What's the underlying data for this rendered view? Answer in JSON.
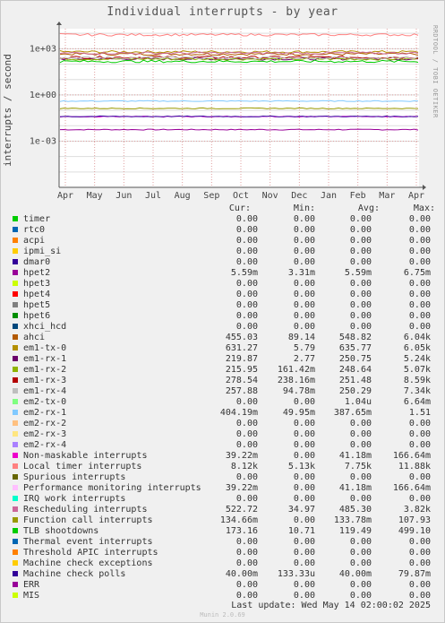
{
  "chart_data": {
    "type": "line",
    "title": "Individual interrupts - by year",
    "ylabel": "interrupts / second",
    "yscale": "log",
    "ylim": [
      1e-06,
      20000
    ],
    "yticks": [
      {
        "label": "1e+03",
        "value": 1000
      },
      {
        "label": "1e+00",
        "value": 1
      },
      {
        "label": "1e-03",
        "value": 0.001
      }
    ],
    "x": [
      "Apr",
      "May",
      "Jun",
      "Jul",
      "Aug",
      "Sep",
      "Oct",
      "Nov",
      "Dec",
      "Jan",
      "Feb",
      "Mar",
      "Apr"
    ],
    "series": [
      {
        "name": "timer",
        "color": "#00cc00",
        "cur": "0.00",
        "min": "0.00",
        "avg": "0.00",
        "max": "0.00",
        "level": 0
      },
      {
        "name": "rtc0",
        "color": "#0066b3",
        "cur": "0.00",
        "min": "0.00",
        "avg": "0.00",
        "max": "0.00",
        "level": 0
      },
      {
        "name": "acpi",
        "color": "#ff8000",
        "cur": "0.00",
        "min": "0.00",
        "avg": "0.00",
        "max": "0.00",
        "level": 0
      },
      {
        "name": "ipmi_si",
        "color": "#ffcc00",
        "cur": "0.00",
        "min": "0.00",
        "avg": "0.00",
        "max": "0.00",
        "level": 0
      },
      {
        "name": "dmar0",
        "color": "#330099",
        "cur": "0.00",
        "min": "0.00",
        "avg": "0.00",
        "max": "0.00",
        "level": 0
      },
      {
        "name": "hpet2",
        "color": "#990099",
        "cur": "5.59m",
        "min": "3.31m",
        "avg": "5.59m",
        "max": "6.75m",
        "level": 0.0056
      },
      {
        "name": "hpet3",
        "color": "#ccff00",
        "cur": "0.00",
        "min": "0.00",
        "avg": "0.00",
        "max": "0.00",
        "level": 0
      },
      {
        "name": "hpet4",
        "color": "#ff0000",
        "cur": "0.00",
        "min": "0.00",
        "avg": "0.00",
        "max": "0.00",
        "level": 0
      },
      {
        "name": "hpet5",
        "color": "#808080",
        "cur": "0.00",
        "min": "0.00",
        "avg": "0.00",
        "max": "0.00",
        "level": 0
      },
      {
        "name": "hpet6",
        "color": "#008f00",
        "cur": "0.00",
        "min": "0.00",
        "avg": "0.00",
        "max": "0.00",
        "level": 0
      },
      {
        "name": "xhci_hcd",
        "color": "#00487d",
        "cur": "0.00",
        "min": "0.00",
        "avg": "0.00",
        "max": "0.00",
        "level": 0
      },
      {
        "name": "ahci",
        "color": "#b35a00",
        "cur": "455.03",
        "min": "89.14",
        "avg": "548.82",
        "max": "6.04k",
        "level": 450
      },
      {
        "name": "em1-tx-0",
        "color": "#b38f00",
        "cur": "631.27",
        "min": "5.79",
        "avg": "635.77",
        "max": "6.05k",
        "level": 630
      },
      {
        "name": "em1-rx-1",
        "color": "#6b006b",
        "cur": "219.87",
        "min": "2.77",
        "avg": "250.75",
        "max": "5.24k",
        "level": 220
      },
      {
        "name": "em1-rx-2",
        "color": "#8fb300",
        "cur": "215.95",
        "min": "161.42m",
        "avg": "248.64",
        "max": "5.07k",
        "level": 216
      },
      {
        "name": "em1-rx-3",
        "color": "#b30000",
        "cur": "278.54",
        "min": "238.16m",
        "avg": "251.48",
        "max": "8.59k",
        "level": 278
      },
      {
        "name": "em1-rx-4",
        "color": "#bebebe",
        "cur": "257.88",
        "min": "94.78m",
        "avg": "250.29",
        "max": "7.34k",
        "level": 258
      },
      {
        "name": "em2-tx-0",
        "color": "#80ff80",
        "cur": "0.00",
        "min": "0.00",
        "avg": "1.04u",
        "max": "6.64m",
        "level": 0
      },
      {
        "name": "em2-rx-1",
        "color": "#80c9ff",
        "cur": "404.19m",
        "min": "49.95m",
        "avg": "387.65m",
        "max": "1.51",
        "level": 0.4
      },
      {
        "name": "em2-rx-2",
        "color": "#ffc080",
        "cur": "0.00",
        "min": "0.00",
        "avg": "0.00",
        "max": "0.00",
        "level": 0
      },
      {
        "name": "em2-rx-3",
        "color": "#ffe680",
        "cur": "0.00",
        "min": "0.00",
        "avg": "0.00",
        "max": "0.00",
        "level": 0
      },
      {
        "name": "em2-rx-4",
        "color": "#aa80ff",
        "cur": "0.00",
        "min": "0.00",
        "avg": "0.00",
        "max": "0.00",
        "level": 0
      },
      {
        "name": "Non-maskable interrupts",
        "color": "#ee00cc",
        "cur": "39.22m",
        "min": "0.00",
        "avg": "41.18m",
        "max": "166.64m",
        "level": 0.039
      },
      {
        "name": "Local timer interrupts",
        "color": "#ff8080",
        "cur": "8.12k",
        "min": "5.13k",
        "avg": "7.75k",
        "max": "11.88k",
        "level": 8120
      },
      {
        "name": "Spurious interrupts",
        "color": "#666600",
        "cur": "0.00",
        "min": "0.00",
        "avg": "0.00",
        "max": "0.00",
        "level": 0
      },
      {
        "name": "Performance monitoring interrupts",
        "color": "#ffbfff",
        "cur": "39.22m",
        "min": "0.00",
        "avg": "41.18m",
        "max": "166.64m",
        "level": 0.039
      },
      {
        "name": "IRQ work interrupts",
        "color": "#00ffcc",
        "cur": "0.00",
        "min": "0.00",
        "avg": "0.00",
        "max": "0.00",
        "level": 0
      },
      {
        "name": "Rescheduling interrupts",
        "color": "#cc6699",
        "cur": "522.72",
        "min": "34.97",
        "avg": "485.30",
        "max": "3.82k",
        "level": 520
      },
      {
        "name": "Function call interrupts",
        "color": "#999900",
        "cur": "134.66m",
        "min": "0.00",
        "avg": "133.78m",
        "max": "107.93",
        "level": 0.134
      },
      {
        "name": "TLB shootdowns",
        "color": "#00cc00",
        "cur": "173.16",
        "min": "10.71",
        "avg": "119.49",
        "max": "499.10",
        "level": 150
      },
      {
        "name": "Thermal event interrupts",
        "color": "#0066b3",
        "cur": "0.00",
        "min": "0.00",
        "avg": "0.00",
        "max": "0.00",
        "level": 0
      },
      {
        "name": "Threshold APIC interrupts",
        "color": "#ff8000",
        "cur": "0.00",
        "min": "0.00",
        "avg": "0.00",
        "max": "0.00",
        "level": 0
      },
      {
        "name": "Machine check exceptions",
        "color": "#ffcc00",
        "cur": "0.00",
        "min": "0.00",
        "avg": "0.00",
        "max": "0.00",
        "level": 0
      },
      {
        "name": "Machine check polls",
        "color": "#330099",
        "cur": "40.00m",
        "min": "133.33u",
        "avg": "40.00m",
        "max": "79.87m",
        "level": 0.04
      },
      {
        "name": "ERR",
        "color": "#990099",
        "cur": "0.00",
        "min": "0.00",
        "avg": "0.00",
        "max": "0.00",
        "level": 0
      },
      {
        "name": "MIS",
        "color": "#ccff00",
        "cur": "0.00",
        "min": "0.00",
        "avg": "0.00",
        "max": "0.00",
        "level": 0
      }
    ]
  },
  "legend": {
    "cur": "Cur:",
    "min": "Min:",
    "avg": "Avg:",
    "max": "Max:"
  },
  "side_credit": "RRDTOOL / TOBI OETIKER",
  "footer": "Last update:  Wed May 14 02:00:02 2025",
  "munin": "Munin 2.0.69"
}
